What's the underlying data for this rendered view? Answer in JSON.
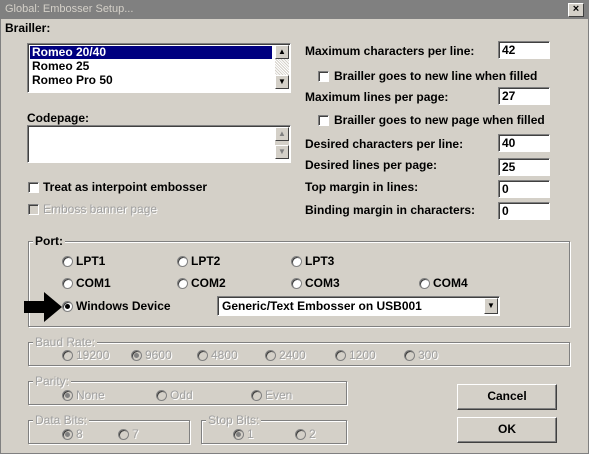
{
  "window": {
    "title": "Global: Embosser Setup...",
    "close_glyph": "×"
  },
  "brailler": {
    "label": "Brailler:",
    "items": [
      "Romeo 20/40",
      "Romeo 25",
      "Romeo Pro 50"
    ],
    "selected_index": 0
  },
  "codepage": {
    "label": "Codepage:",
    "value": ""
  },
  "settings": {
    "max_chars_label": "Maximum characters per line:",
    "max_chars_value": "42",
    "new_line_label": "Brailler goes to new line when filled",
    "max_lines_label": "Maximum lines per page:",
    "max_lines_value": "27",
    "new_page_label": "Brailler goes to new page when filled",
    "desired_chars_label": "Desired characters per line:",
    "desired_chars_value": "40",
    "desired_lines_label": "Desired lines per page:",
    "desired_lines_value": "25",
    "top_margin_label": "Top margin in lines:",
    "top_margin_value": "0",
    "binding_margin_label": "Binding margin in characters:",
    "binding_margin_value": "0"
  },
  "options": {
    "interpoint_label": "Treat as interpoint embosser",
    "banner_label": "Emboss banner page"
  },
  "port": {
    "label": "Port:",
    "lpt1": "LPT1",
    "lpt2": "LPT2",
    "lpt3": "LPT3",
    "com1": "COM1",
    "com2": "COM2",
    "com3": "COM3",
    "com4": "COM4",
    "windows_device": "Windows Device",
    "device_value": "Generic/Text Embosser on USB001",
    "selected": "windows_device"
  },
  "baud": {
    "label": "Baud Rate:",
    "options": [
      "19200",
      "9600",
      "4800",
      "2400",
      "1200",
      "300"
    ],
    "selected": "9600"
  },
  "parity": {
    "label": "Parity:",
    "options": [
      "None",
      "Odd",
      "Even"
    ],
    "selected": "None"
  },
  "data_bits": {
    "label": "Data Bits:",
    "options": [
      "8",
      "7"
    ],
    "selected": "8"
  },
  "stop_bits": {
    "label": "Stop Bits:",
    "options": [
      "1",
      "2"
    ],
    "selected": "1"
  },
  "buttons": {
    "cancel": "Cancel",
    "ok": "OK"
  },
  "icons": {
    "pointer": "right-arrow-icon",
    "scroll_up": "▲",
    "scroll_down": "▼"
  }
}
